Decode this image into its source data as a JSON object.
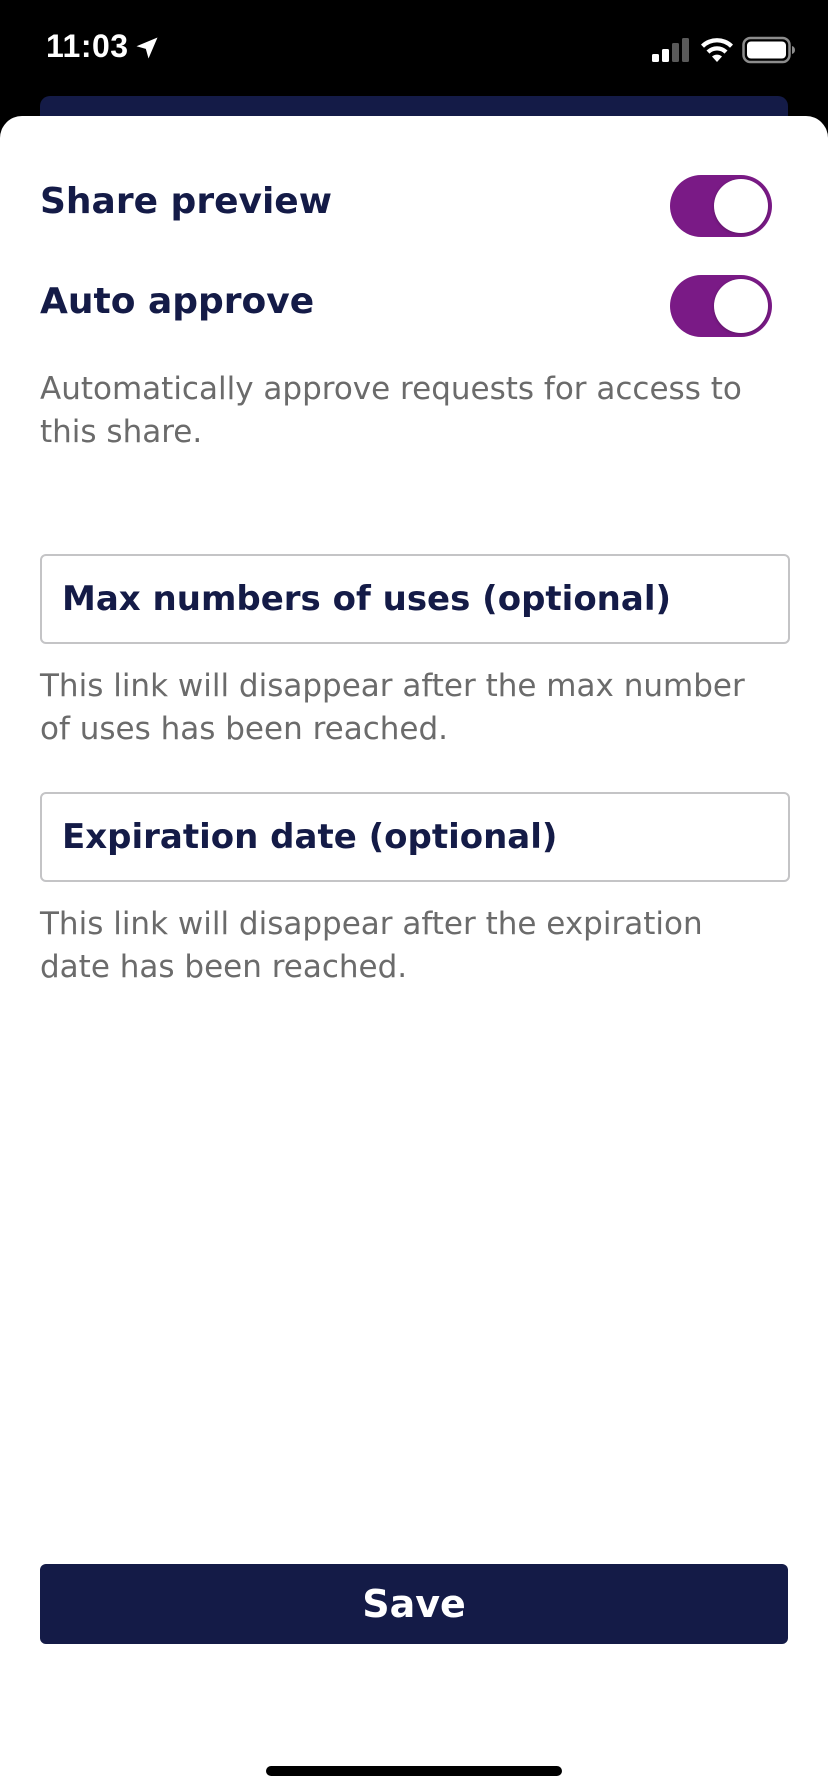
{
  "status_bar": {
    "time": "11:03",
    "icons": [
      "location-arrow-icon",
      "cellular-signal-icon",
      "wifi-icon",
      "battery-icon"
    ]
  },
  "settings": {
    "share_preview": {
      "label": "Share preview",
      "enabled": true
    },
    "auto_approve": {
      "label": "Auto approve",
      "enabled": true,
      "description": "Automatically approve requests for access to this share."
    }
  },
  "max_uses": {
    "placeholder": "Max numbers of uses (optional)",
    "value": "",
    "helper": "This link will disappear after the max number of uses has been reached."
  },
  "expiration": {
    "placeholder": "Expiration date (optional)",
    "value": "",
    "helper": "This link will disappear after the expiration date has been reached."
  },
  "actions": {
    "save_label": "Save"
  },
  "colors": {
    "navy": "#141b47",
    "toggle_on": "#7a1a86",
    "helper_text": "#6b6b6b",
    "field_border": "#c4c4c6"
  }
}
